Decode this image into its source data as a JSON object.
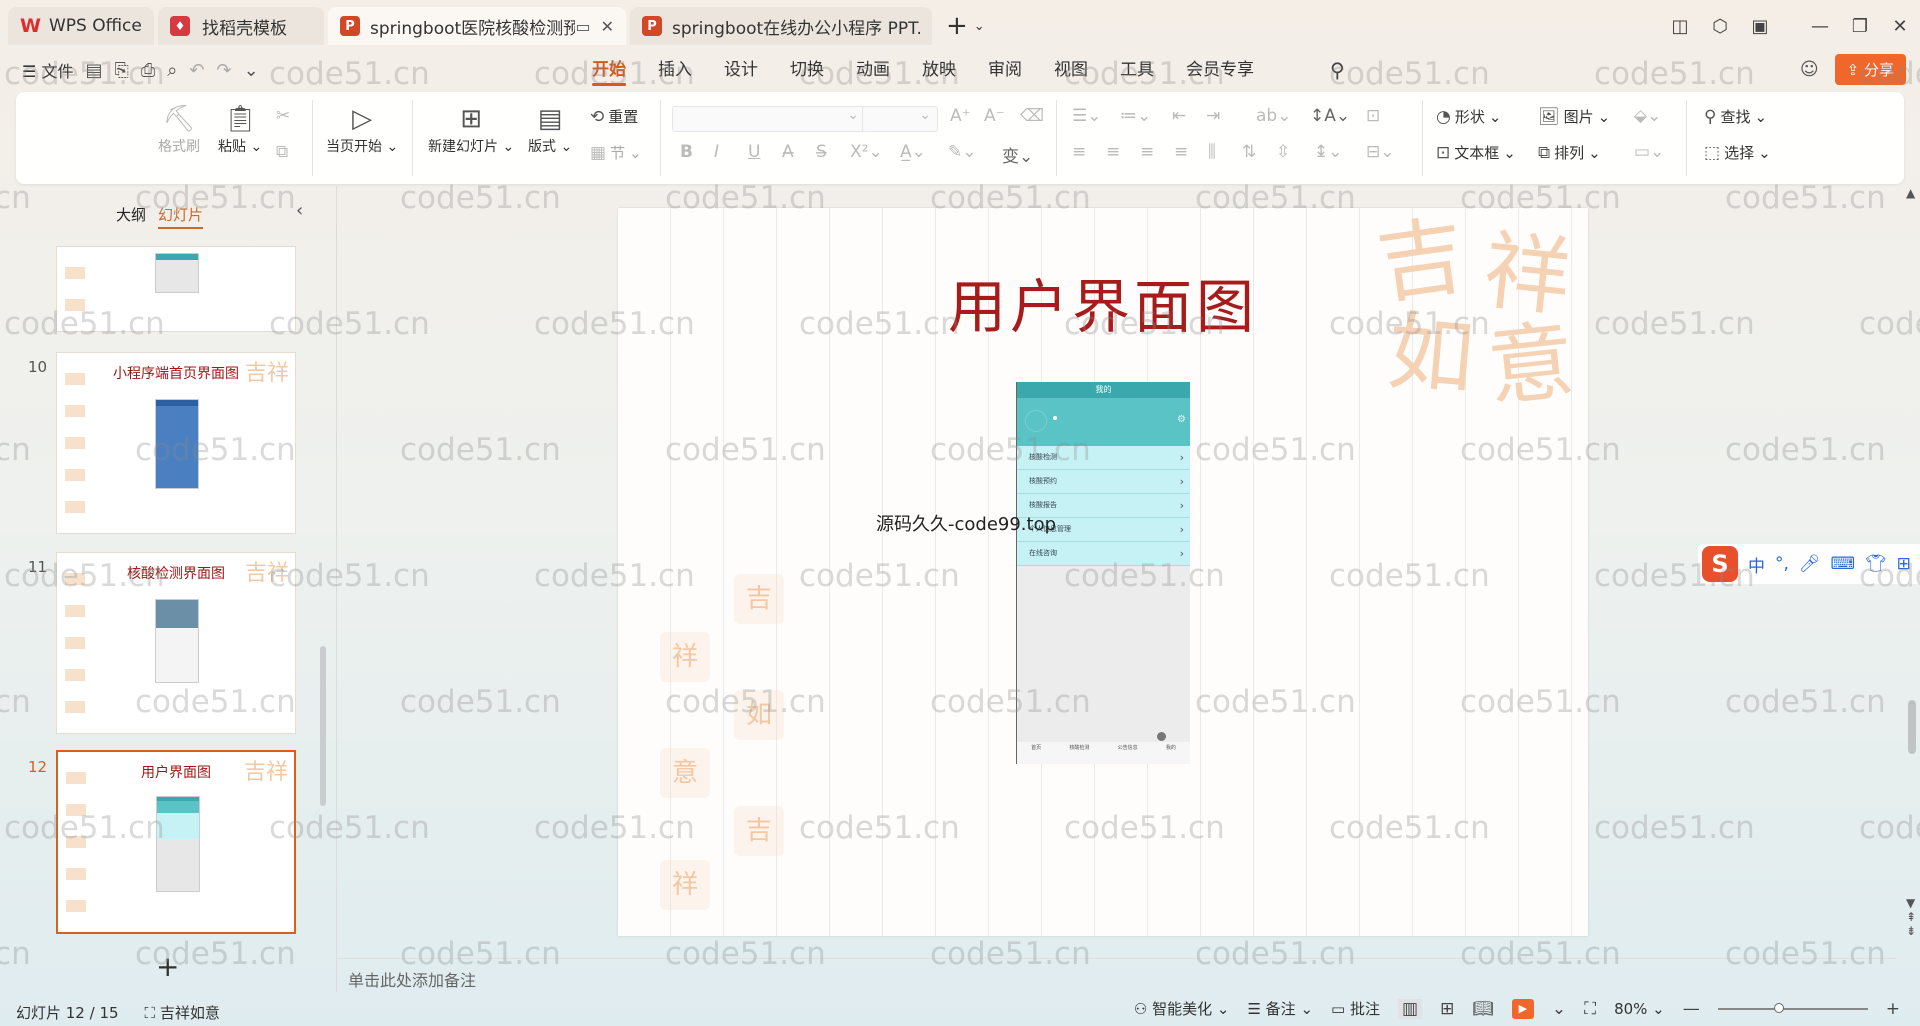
{
  "titlebar": {
    "tabs": [
      {
        "label": "WPS Office",
        "kind": "home"
      },
      {
        "label": "找稻壳模板",
        "kind": "docer"
      },
      {
        "label": "springboot医院核酸检测预约",
        "kind": "ppt",
        "active": true
      },
      {
        "label": "springboot在线办公小程序 PPT.ppt",
        "kind": "ppt"
      }
    ],
    "new_tab_icon": "plus-icon"
  },
  "menubar": {
    "file_label": "文件",
    "tabs": [
      "开始",
      "插入",
      "设计",
      "切换",
      "动画",
      "放映",
      "审阅",
      "视图",
      "工具",
      "会员专享"
    ],
    "active_tab": "开始",
    "share_label": "分享"
  },
  "ribbon": {
    "format_painter": "格式刷",
    "paste": "粘贴",
    "play_from_current": "当页开始",
    "new_slide": "新建幻灯片",
    "layout": "版式",
    "reset": "重置",
    "section": "节",
    "shapes": "形状",
    "picture": "图片",
    "find": "查找",
    "textbox": "文本框",
    "arrange": "排列",
    "select": "选择"
  },
  "left_panel": {
    "outline_tab": "大纲",
    "slides_tab": "幻灯片",
    "thumbnails": [
      {
        "number": "",
        "title": ""
      },
      {
        "number": "10",
        "title": "小程序端首页界面图"
      },
      {
        "number": "11",
        "title": "核酸检测界面图"
      },
      {
        "number": "12",
        "title": "用户界面图",
        "selected": true
      }
    ]
  },
  "slide": {
    "title": "用户界面图",
    "overlay_text": "源码久久-code99.top",
    "phone": {
      "header": "我的",
      "rows": [
        "核酸检测",
        "核酸预约",
        "核酸报告",
        "个人信息管理",
        "在线咨询"
      ],
      "nav": [
        "首页",
        "核酸检测",
        "公告信息",
        "我的"
      ]
    }
  },
  "notes": {
    "placeholder": "单击此处添加备注"
  },
  "ime": {
    "items": [
      "中",
      "°,"
    ]
  },
  "statusbar": {
    "slide_counter": "幻灯片 12 / 15",
    "theme": "吉祥如意",
    "beautify": "智能美化",
    "notes": "备注",
    "comments": "批注",
    "zoom": "80%"
  },
  "watermark": {
    "text": "code51.cn"
  },
  "colors": {
    "accent": "#d8581e",
    "slide_title": "#a71b1b",
    "share": "#f1662a"
  }
}
